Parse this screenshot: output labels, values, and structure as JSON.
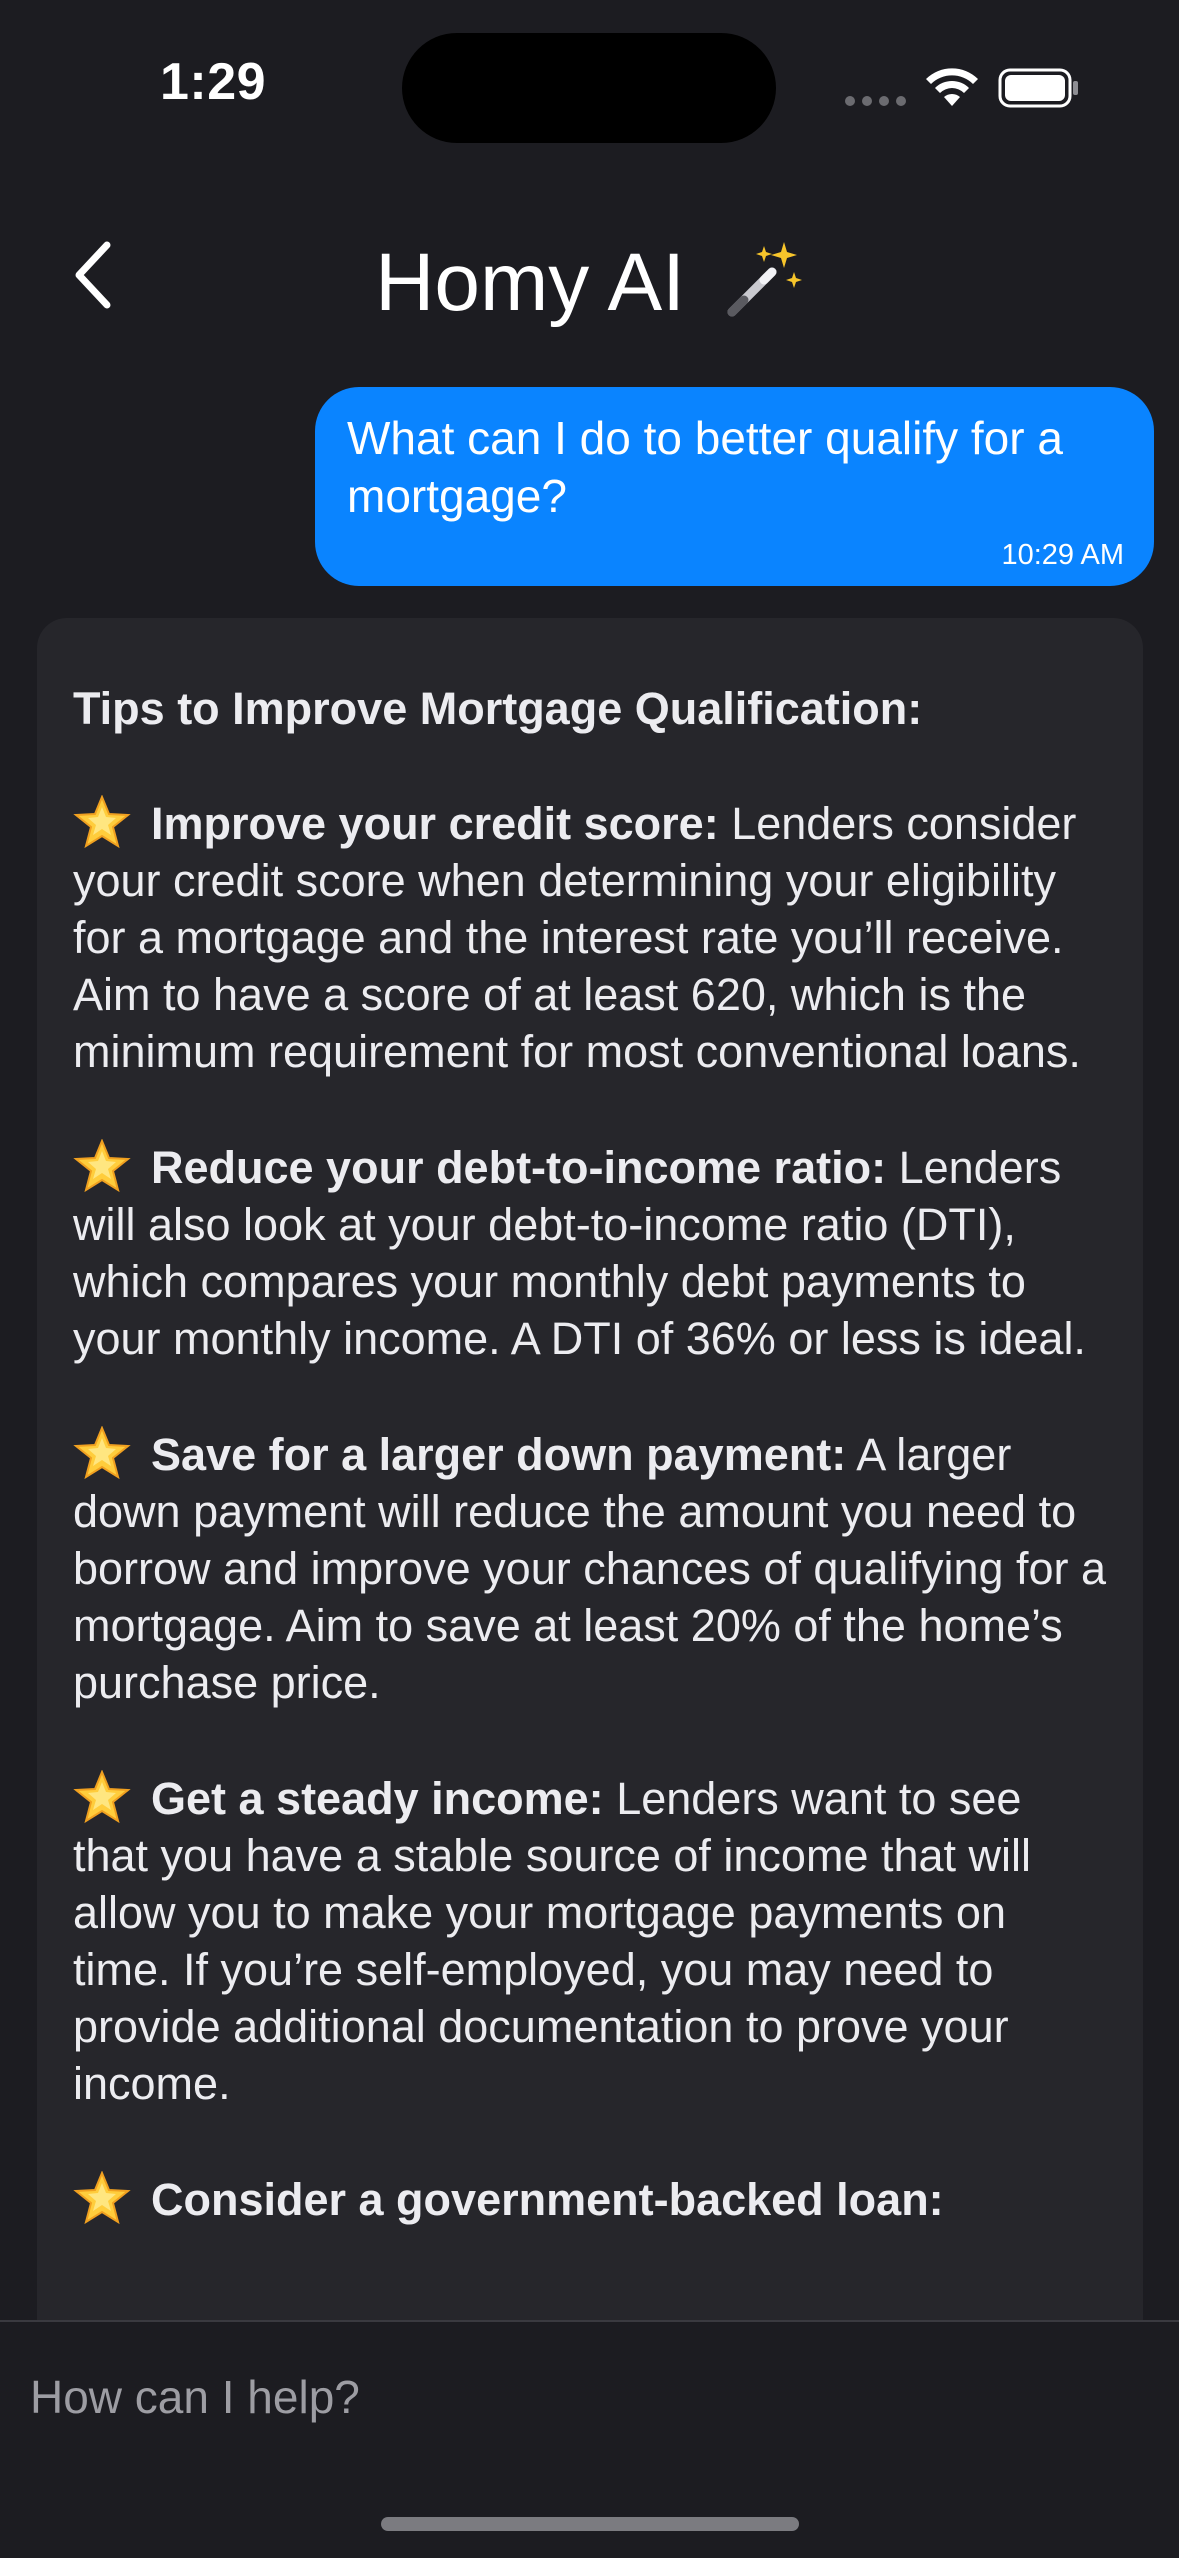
{
  "status_bar": {
    "time": "1:29"
  },
  "header": {
    "title": "Homy AI",
    "back_icon": "chevron-left-icon",
    "title_icon": "magic-wand-icon"
  },
  "conversation": {
    "user_message": {
      "text": "What can I do to better qualify for a mortgage?",
      "time": "10:29 AM"
    },
    "assistant_message": {
      "heading": "Tips to Improve Mortgage Qualification:",
      "tips": [
        {
          "icon": "star-icon",
          "title": "Improve your credit score:",
          "body": "Lenders consider your credit score when determining your eligibility for a mortgage and the interest rate you’ll receive. Aim to have a score of at least 620, which is the minimum requirement for most conventional loans."
        },
        {
          "icon": "star-icon",
          "title": "Reduce your debt-to-income ratio:",
          "body": "Lenders will also look at your debt-to-income ratio (DTI), which compares your monthly debt payments to your monthly income. A DTI of 36% or less is ideal."
        },
        {
          "icon": "star-icon",
          "title": "Save for a larger down payment:",
          "body": "A larger down payment will reduce the amount you need to borrow and improve your chances of qualifying for a mortgage. Aim to save at least 20% of the home’s purchase price."
        },
        {
          "icon": "star-icon",
          "title": "Get a steady income:",
          "body": "Lenders want to see that you have a stable source of income that will allow you to make your mortgage payments on time. If you’re self-employed, you may need to provide additional documentation to prove your income."
        },
        {
          "icon": "star-icon",
          "title": "Consider a government-backed loan:",
          "body": ""
        }
      ]
    }
  },
  "composer": {
    "placeholder": "How can I help?"
  },
  "colors": {
    "background": "#1c1c21",
    "card": "#26262b",
    "user_bubble": "#0a84ff"
  }
}
